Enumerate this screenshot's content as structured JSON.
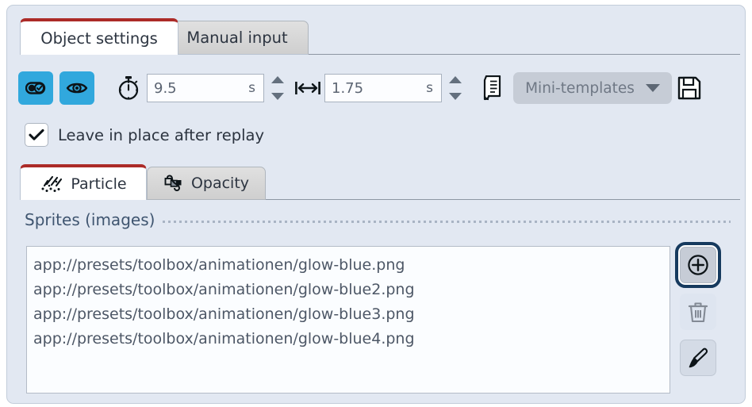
{
  "window": {
    "background_color": "#e2e8f2",
    "accent_color": "#ac2b28",
    "toggle_color": "#31a8dd"
  },
  "tabs": [
    {
      "label": "Object settings",
      "active": true
    },
    {
      "label": "Manual input",
      "active": false
    }
  ],
  "toolbar": {
    "enable_icon": "toggle-check-icon",
    "visible_icon": "eye-icon",
    "interval": {
      "icon": "stopwatch-icon",
      "value": "9.5",
      "unit": "s"
    },
    "duration": {
      "icon": "duration-arrow-icon",
      "value": "1.75",
      "unit": "s"
    },
    "script_icon": "script-document-icon",
    "dropdown": {
      "label": "Mini-templates",
      "caret": "chevron-down-icon"
    },
    "save_icon": "floppy-save-icon"
  },
  "checkbox": {
    "label": "Leave in place after replay",
    "checked": true
  },
  "inner_tabs": [
    {
      "label": "Particle",
      "icon": "particle-icon",
      "active": true
    },
    {
      "label": "Opacity",
      "icon": "opacity-icon",
      "active": false
    }
  ],
  "section": {
    "title": "Sprites (images)"
  },
  "sprite_list": [
    "app://presets/toolbox/animationen/glow-blue.png",
    "app://presets/toolbox/animationen/glow-blue2.png",
    "app://presets/toolbox/animationen/glow-blue3.png",
    "app://presets/toolbox/animationen/glow-blue4.png"
  ],
  "side_actions": [
    {
      "name": "add",
      "icon": "plus-circle-icon",
      "focused": true
    },
    {
      "name": "delete",
      "icon": "trash-icon",
      "disabled": true
    },
    {
      "name": "edit",
      "icon": "brush-icon",
      "disabled": false
    }
  ]
}
